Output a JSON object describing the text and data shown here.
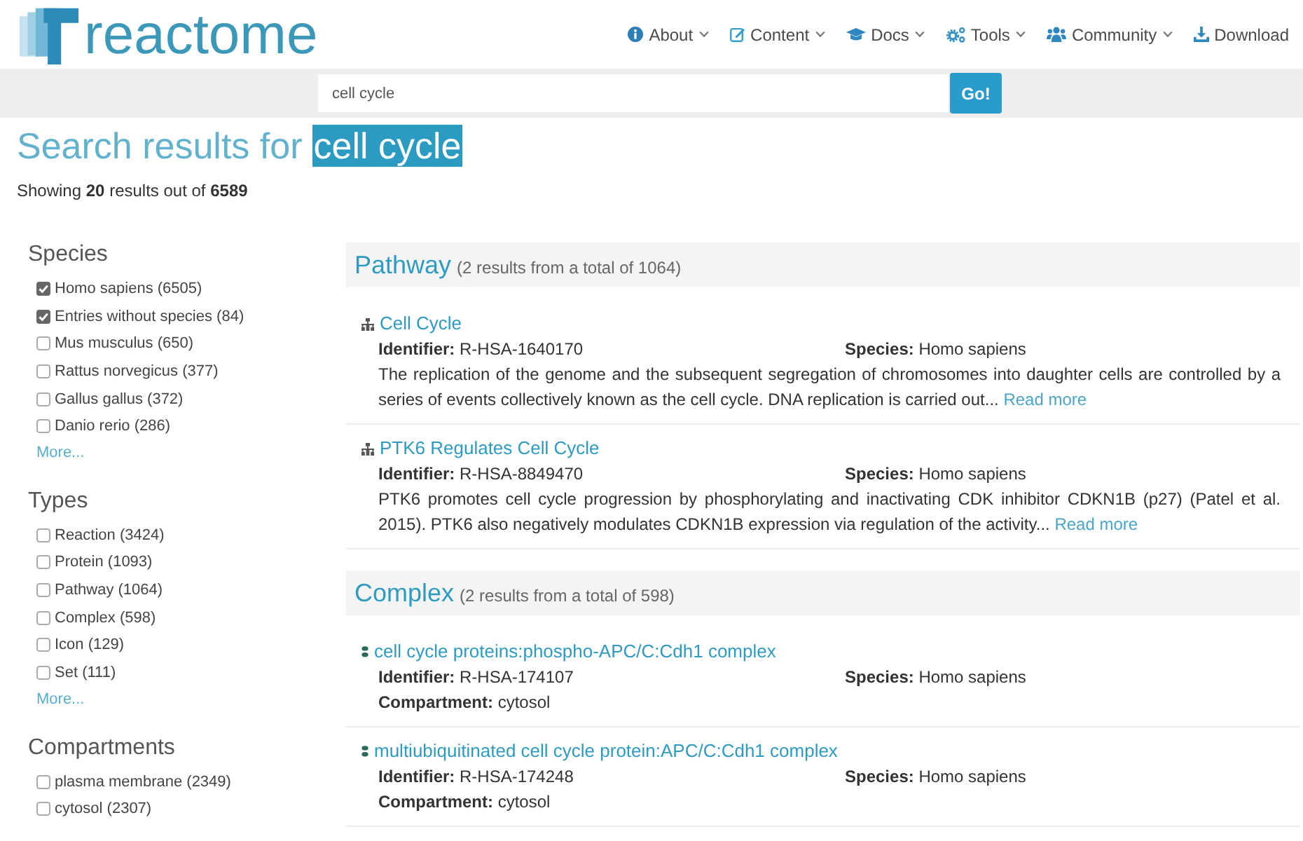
{
  "header": {
    "logo_text": "reactome",
    "nav": [
      {
        "label": "About",
        "kind": "info",
        "dropdown": true
      },
      {
        "label": "Content",
        "kind": "edit",
        "dropdown": true
      },
      {
        "label": "Docs",
        "kind": "cap",
        "dropdown": true
      },
      {
        "label": "Tools",
        "kind": "gears",
        "dropdown": true
      },
      {
        "label": "Community",
        "kind": "users",
        "dropdown": true
      },
      {
        "label": "Download",
        "kind": "download",
        "dropdown": false
      }
    ]
  },
  "search": {
    "value": "cell cycle",
    "button": "Go!"
  },
  "results_heading": {
    "text": "Search results for",
    "query": "cell cycle",
    "summary": "Showing **20** results out of **6589**"
  },
  "facets": [
    {
      "title": "Species",
      "items": [
        {
          "label": "Homo sapiens (6505)",
          "checked": true
        },
        {
          "label": "Entries without species (84)",
          "checked": true
        },
        {
          "label": "Mus musculus (650)",
          "checked": false
        },
        {
          "label": "Rattus norvegicus (377)",
          "checked": false
        },
        {
          "label": "Gallus gallus (372)",
          "checked": false
        },
        {
          "label": "Danio rerio (286)",
          "checked": false
        }
      ],
      "more": "More..."
    },
    {
      "title": "Types",
      "items": [
        {
          "label": "Reaction (3424)",
          "checked": false
        },
        {
          "label": "Protein (1093)",
          "checked": false
        },
        {
          "label": "Pathway (1064)",
          "checked": false
        },
        {
          "label": "Complex (598)",
          "checked": false
        },
        {
          "label": "Icon (129)",
          "checked": false
        },
        {
          "label": "Set (111)",
          "checked": false
        }
      ],
      "more": "More..."
    },
    {
      "title": "Compartments",
      "items": [
        {
          "label": "plasma membrane (2349)",
          "checked": false
        },
        {
          "label": "cytosol (2307)",
          "checked": false
        }
      ]
    }
  ],
  "sections": [
    {
      "title": "Pathway",
      "count": "(2 results from a total of 1064)",
      "results": [
        {
          "kind": "pathway",
          "title": "Cell Cycle",
          "identifier": "**Identifier:** R-HSA-1640170",
          "species": "**Species:** Homo sapiens",
          "description": "The replication of the genome and the subsequent segregation of chromosomes into daughter cells are controlled by a series of events collectively known as the cell cycle. DNA replication is carried out...",
          "read_more": "Read more"
        },
        {
          "kind": "pathway",
          "title": "PTK6 Regulates Cell Cycle",
          "identifier": "**Identifier:** R-HSA-8849470",
          "species": "**Species:** Homo sapiens",
          "description": "PTK6 promotes cell cycle progression by phosphorylating and inactivating CDK inhibitor CDKN1B (p27) (Patel et al. 2015). PTK6 also negatively modulates CDKN1B expression via regulation of the activity...",
          "read_more": "Read more"
        }
      ]
    },
    {
      "title": "Complex",
      "count": "(2 results from a total of 598)",
      "results": [
        {
          "kind": "complex",
          "title": "cell cycle proteins:phospho-APC/C:Cdh1 complex",
          "identifier": "**Identifier:** R-HSA-174107",
          "species": "**Species:** Homo sapiens",
          "compartment": "**Compartment:** cytosol"
        },
        {
          "kind": "complex",
          "title": "multiubiquitinated cell cycle protein:APC/C:Cdh1 complex",
          "identifier": "**Identifier:** R-HSA-174248",
          "species": "**Species:** Homo sapiens",
          "compartment": "**Compartment:** cytosol"
        }
      ]
    }
  ]
}
